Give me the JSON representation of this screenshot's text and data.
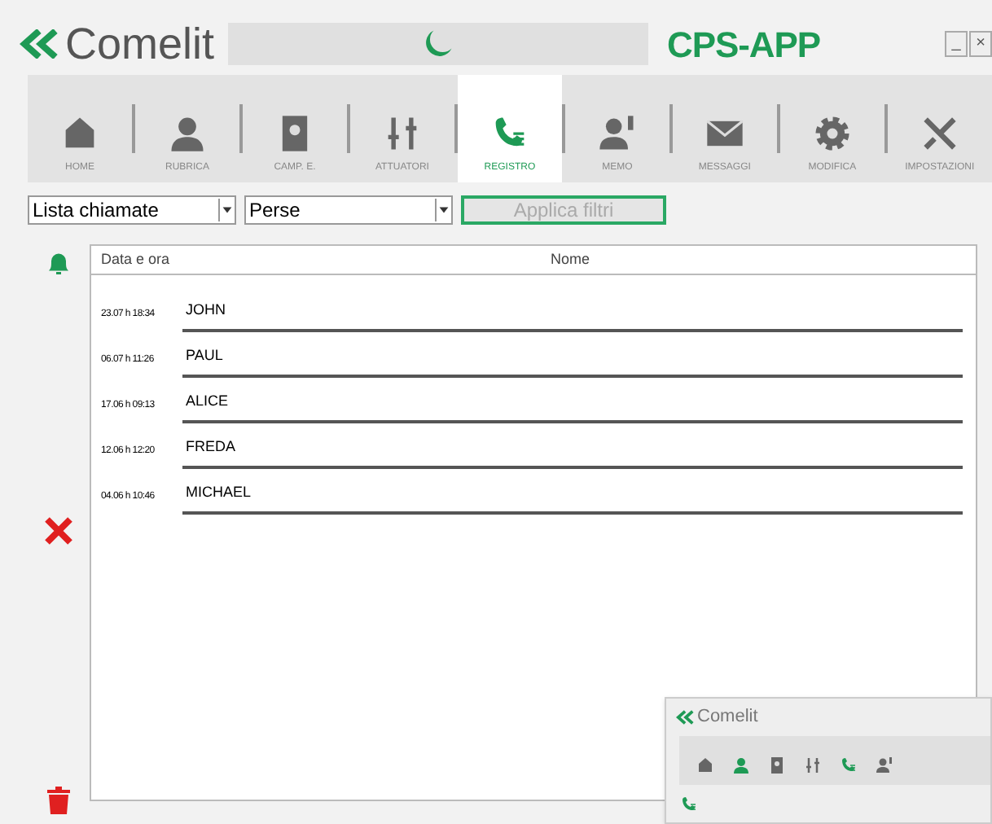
{
  "header": {
    "logo": "Comelit",
    "app_title": "CPS-APP",
    "window_buttons": [
      "_",
      "×"
    ]
  },
  "tabs": [
    {
      "label": "HOME",
      "selected": false
    },
    {
      "label": "RUBRICA",
      "selected": false
    },
    {
      "label": "CAMP. E.",
      "selected": false
    },
    {
      "label": "ATTUATORI",
      "selected": false
    },
    {
      "label": "REGISTRO",
      "selected": true
    },
    {
      "label": "MEMO",
      "selected": false
    },
    {
      "label": "MESSAGGI",
      "selected": false
    },
    {
      "label": "MODIFICA",
      "selected": false
    },
    {
      "label": "IMPOSTAZIONI",
      "selected": false
    }
  ],
  "filters": {
    "list_type": "Lista chiamate",
    "call_type": "Perse",
    "apply_button": "Applica filtri"
  },
  "table": {
    "columns": [
      "Data e ora",
      "Nome"
    ],
    "rows": [
      {
        "datetime": "23.07 h 18:34",
        "name": "JOHN"
      },
      {
        "datetime": "06.07 h 11:26",
        "name": "PAUL"
      },
      {
        "datetime": "17.06 h 09:13",
        "name": "ALICE"
      },
      {
        "datetime": "12.06 h 12:20",
        "name": "FREDA"
      },
      {
        "datetime": "04.06 h 10:46",
        "name": "MICHAEL"
      }
    ]
  },
  "inset": {
    "logo": "Comelit"
  }
}
